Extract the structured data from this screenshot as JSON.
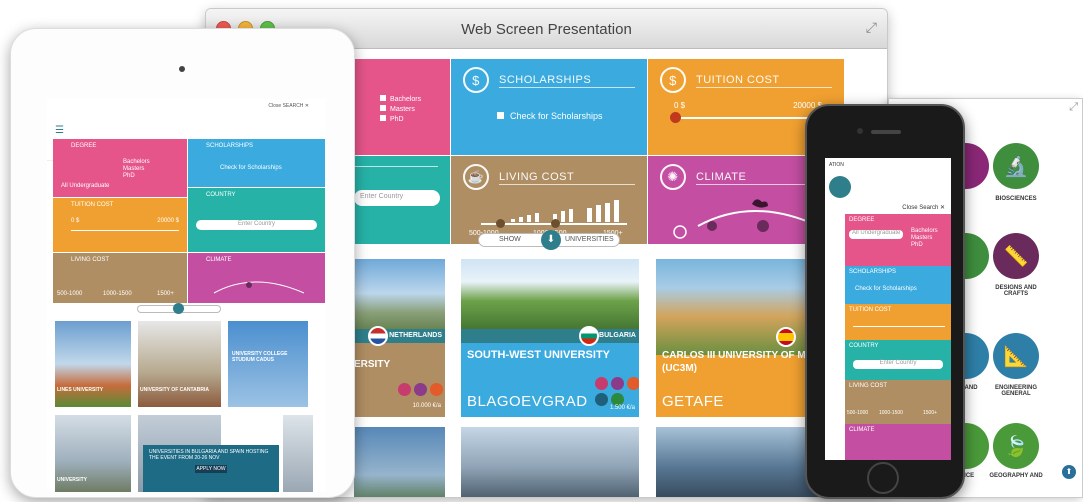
{
  "window": {
    "title": "Web Screen Presentation"
  },
  "tiles": {
    "scholarships": {
      "title": "SCHOLARSHIPS",
      "check": "Check for Scholarships"
    },
    "tuition": {
      "title": "TUITION COST",
      "min": "0 $",
      "max": "20000 $"
    },
    "degrees": {
      "items": [
        "Bachelors",
        "Masters",
        "PhD"
      ]
    },
    "country": {
      "placeholder": "Enter Country"
    },
    "living": {
      "title": "LIVING COST",
      "ranges": [
        "500-1000",
        "1000-1500",
        "1500+"
      ]
    },
    "climate": {
      "title": "CLIMATE"
    }
  },
  "toggle": {
    "left": "SHOW",
    "right": "UNIVERSITIES"
  },
  "universities": [
    {
      "country": "NETHERLANDS",
      "name": "ERSITY",
      "city": "",
      "fee": "10.000 €/a"
    },
    {
      "country": "BULGARIA",
      "name": "SOUTH-WEST UNIVERSITY",
      "city": "BLAGOEVGRAD",
      "fee": "1.500 €/a"
    },
    {
      "country": "",
      "name": "CARLOS III UNIVERSITY OF MADRID (UC3M)",
      "city": "GETAFE",
      "fee": ""
    }
  ],
  "subjects": [
    {
      "label": "BIOSCIENCES",
      "icon": "microscope-icon"
    },
    {
      "label": "DESIGNS AND CRAFTS",
      "icon": "ruler-icon"
    },
    {
      "label": "ENGINEERING GENERAL",
      "icon": "triangle-icon"
    },
    {
      "label": "GEOGRAPHY AND",
      "icon": "leaf-icon"
    }
  ],
  "subjects_partial": [
    "Y",
    "ING AND",
    "IENCE"
  ],
  "ipad": {
    "close": "Close SEARCH ✕",
    "labels": [
      "DEGREE",
      "SCHOLARSHIPS",
      "TUITION COST",
      "COUNTRY",
      "LIVING COST",
      "CLIMATE"
    ],
    "check": "Check for Scholarships",
    "tuition_min": "0 $",
    "tuition_max": "20000 $",
    "degrees": [
      "Bachelors",
      "Masters",
      "PhD"
    ],
    "undergrad": "All Undergraduate",
    "country_placeholder": "Enter Country",
    "living_ranges": [
      "500-1000",
      "1000-1500",
      "1500+"
    ],
    "cards": [
      "LINES UNIVERSITY",
      "UNIVERSITY OF CANTABRIA",
      "UNIVERSITY COLLEGE STUDIUM CADUS",
      "UNIVERSITY"
    ],
    "promo": "UNIVERSITIES IN BULGARIA AND SPAIN HOSTING THE EVENT FROM 20-26 NOV",
    "promo_btn": "APPLY NOW"
  },
  "iphone": {
    "header": "ATION",
    "close": "Close Search ✕",
    "labels": [
      "DEGREE",
      "SCHOLARSHIPS",
      "TUITION COST",
      "COUNTRY",
      "LIVING COST",
      "CLIMATE"
    ],
    "degree_value": "All Undergraduate",
    "degrees": [
      "Bachelors",
      "Masters",
      "PhD"
    ],
    "check": "Check for Scholarships",
    "country_placeholder": "Enter Country",
    "living_ranges": [
      "500-1000",
      "1000-1500",
      "1500+"
    ]
  },
  "colors": {
    "pink": "#e6558a",
    "blue": "#3aaadf",
    "orange": "#f0a030",
    "teal": "#26b2a7",
    "brown": "#b08e63",
    "purple": "#c44fa2",
    "darkteal": "#2e7f8b"
  }
}
